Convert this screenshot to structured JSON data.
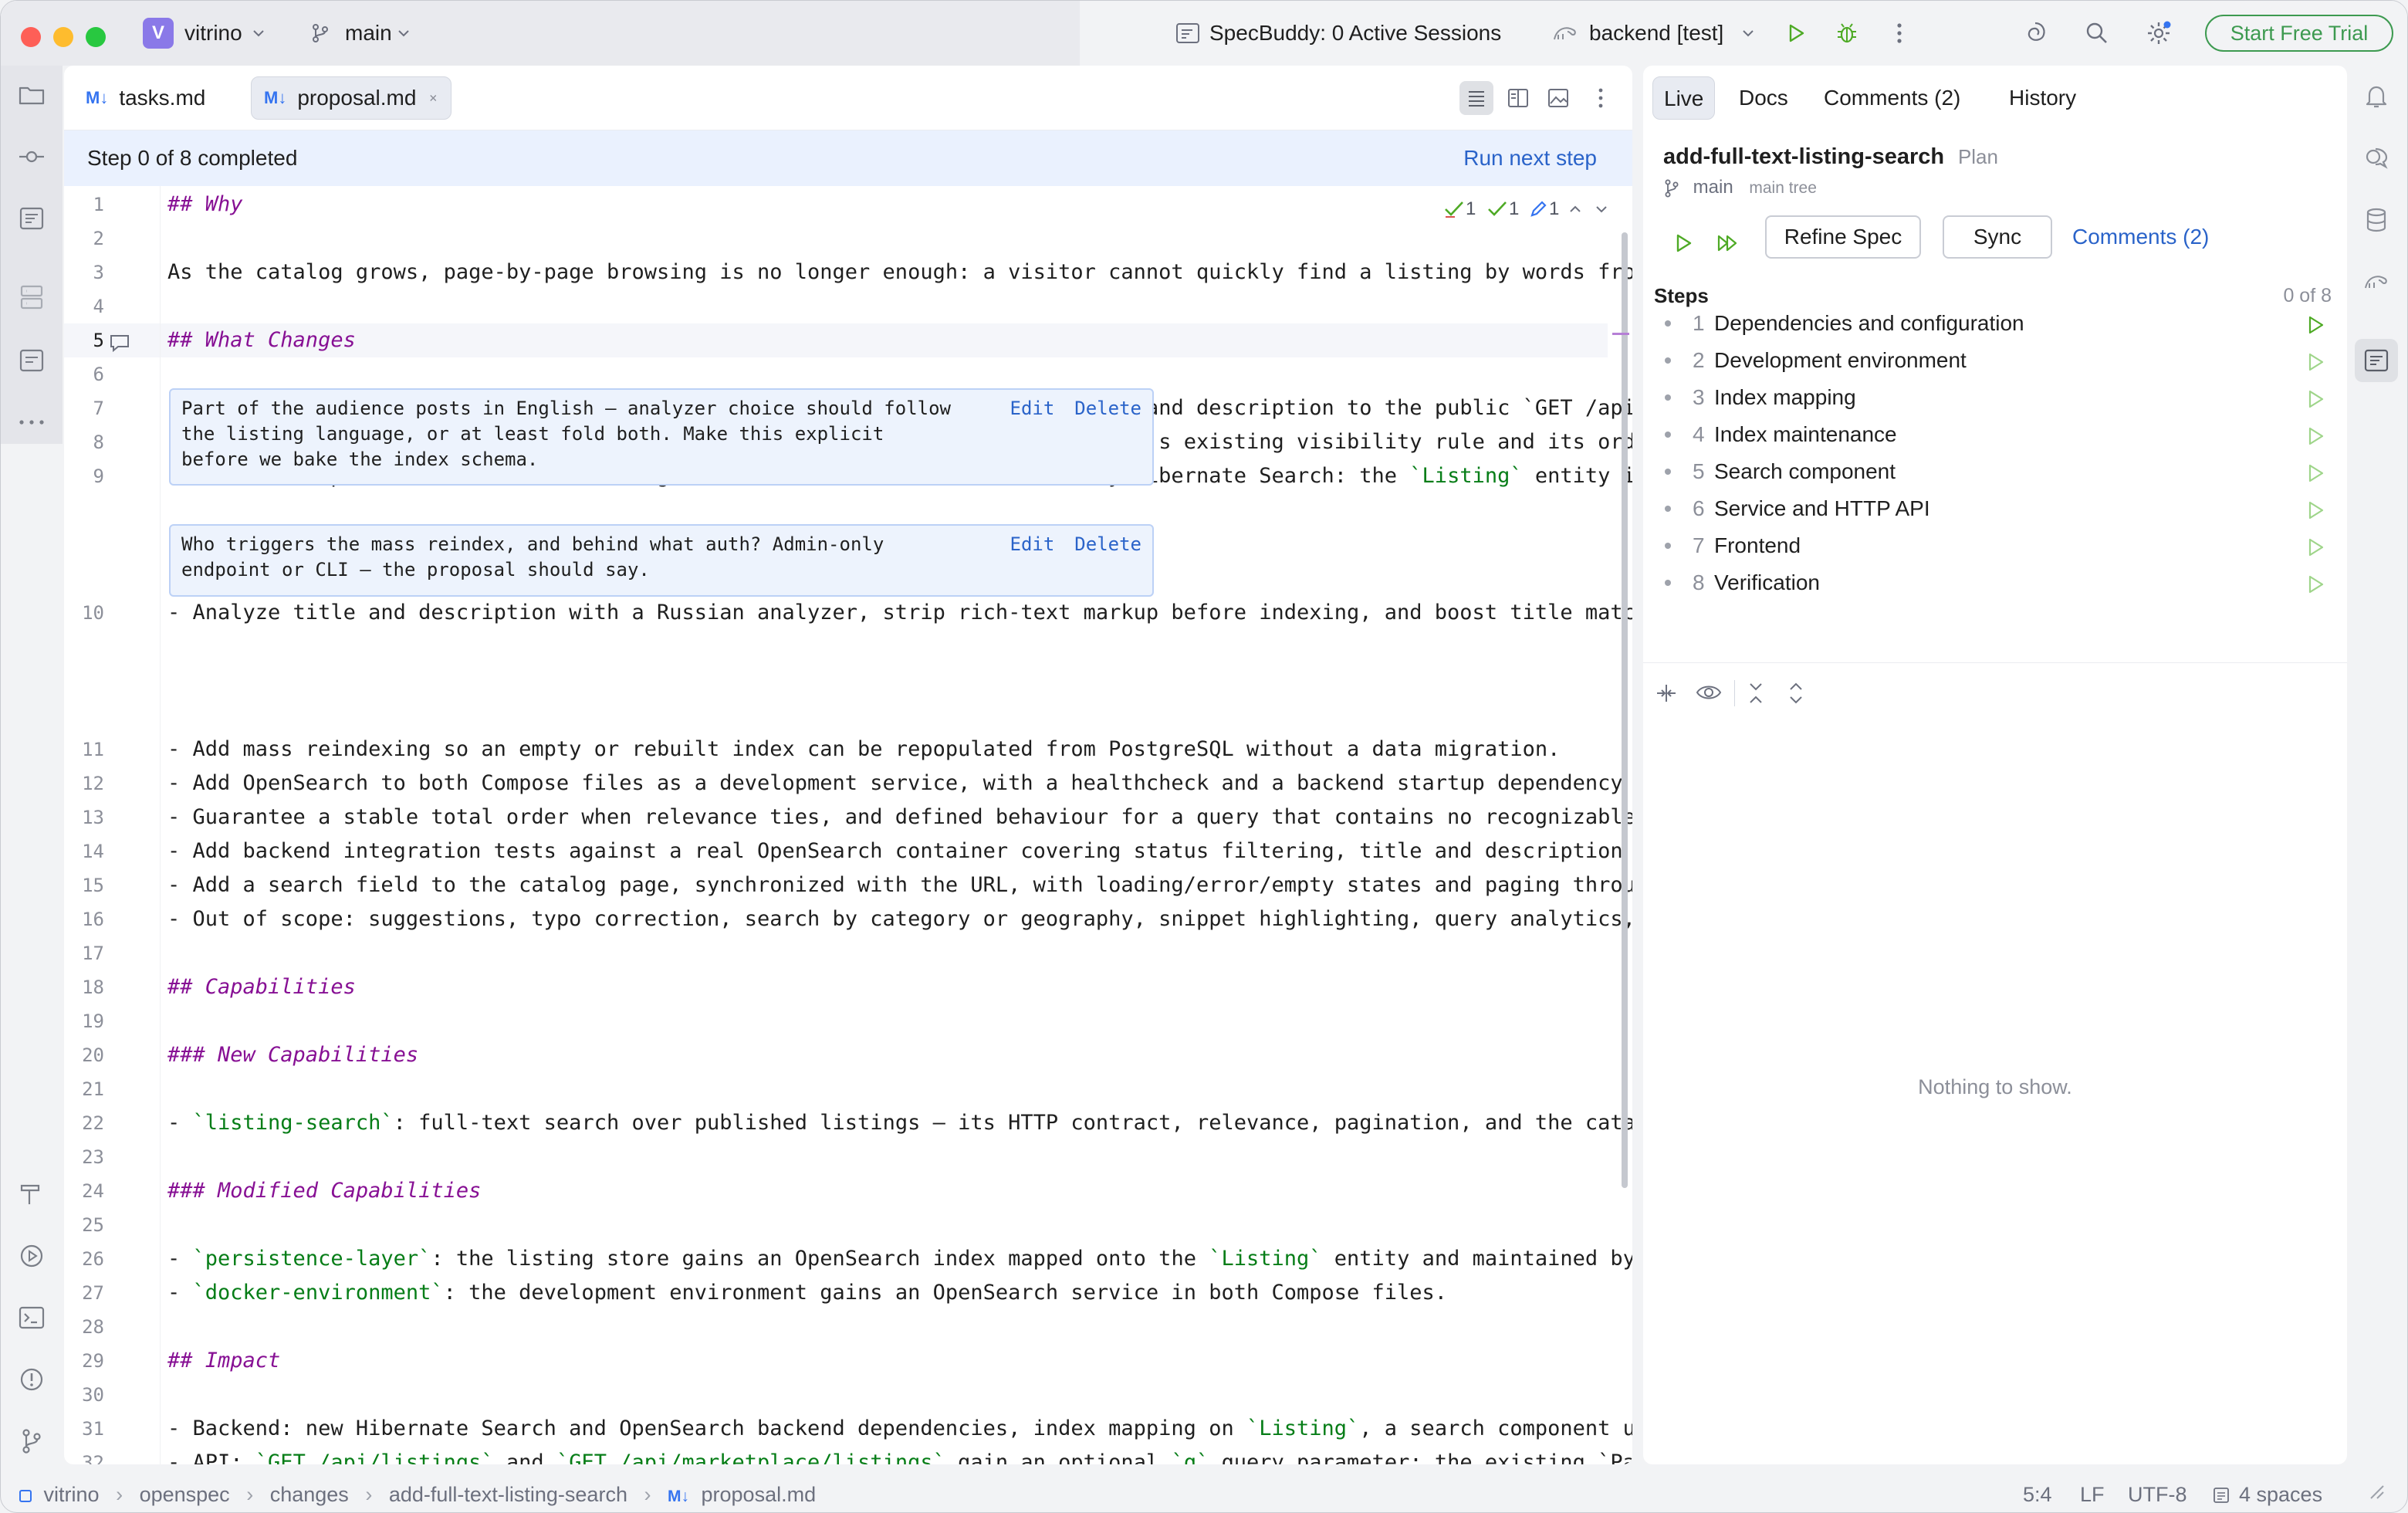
{
  "titlebar": {
    "project_initial": "V",
    "project": "vitrino",
    "branch": "main",
    "specbuddy": "SpecBuddy: 0 Active Sessions",
    "run_config": "backend [test]",
    "trial_button": "Start Free Trial"
  },
  "editor": {
    "tabs": [
      {
        "badge": "M↓",
        "label": "tasks.md"
      },
      {
        "badge": "M↓",
        "label": "proposal.md"
      }
    ],
    "step_status": "Step 0 of 8 completed",
    "run_next": "Run next step",
    "inspections": {
      "a": "1",
      "b": "1",
      "c": "1"
    },
    "lines": [
      {
        "n": "1",
        "t": "## Why",
        "k": "h"
      },
      {
        "n": "2",
        "t": ""
      },
      {
        "n": "3",
        "t": "As the catalog grows, page-by-page browsing is no longer enough: a visitor cannot quickly find a listing by words from its"
      },
      {
        "n": "4",
        "t": ""
      },
      {
        "n": "5",
        "t": "## What Changes",
        "k": "h"
      },
      {
        "n": "6",
        "t": ""
      },
      {
        "n": "7",
        "t": "- Add an optional `q` query parameter for full-text search over listing title and description to the public `GET /api/list"
      },
      {
        "n": "8",
        "t": "- Search only among listings with status `PUBLISHED`, preserving each endpoint's existing visibility rule and its ordinary"
      },
      {
        "n": "9",
        "t": "- Introduce OpenSearch as the search engine, driven from the domain model by Hibernate Search: the `Listing` entity is map"
      },
      {
        "n": "10",
        "t": "- Analyze title and description with a Russian analyzer, strip rich-text markup before indexing, and boost title matches a"
      },
      {
        "n": "11",
        "t": "- Add mass reindexing so an empty or rebuilt index can be repopulated from PostgreSQL without a data migration."
      },
      {
        "n": "12",
        "t": "- Add OpenSearch to both Compose files as a development service, with a healthcheck and a backend startup dependency on it"
      },
      {
        "n": "13",
        "t": "- Guarantee a stable total order when relevance ties, and defined behaviour for a query that contains no recognizable toke"
      },
      {
        "n": "14",
        "t": "- Add backend integration tests against a real OpenSearch container covering status filtering, title and description match"
      },
      {
        "n": "15",
        "t": "- Add a search field to the catalog page, synchronized with the URL, with loading/error/empty states and paging through re"
      },
      {
        "n": "16",
        "t": "- Out of scope: suggestions, typo correction, search by category or geography, snippet highlighting, query analytics, and"
      },
      {
        "n": "17",
        "t": ""
      },
      {
        "n": "18",
        "t": "## Capabilities",
        "k": "h"
      },
      {
        "n": "19",
        "t": ""
      },
      {
        "n": "20",
        "t": "### New Capabilities",
        "k": "h"
      },
      {
        "n": "21",
        "t": ""
      },
      {
        "n": "22",
        "t": "- `listing-search`: full-text search over published listings — its HTTP contract, relevance, pagination, and the catalog p"
      },
      {
        "n": "23",
        "t": ""
      },
      {
        "n": "24",
        "t": "### Modified Capabilities",
        "k": "h"
      },
      {
        "n": "25",
        "t": ""
      },
      {
        "n": "26",
        "t": "- `persistence-layer`: the listing store gains an OpenSearch index mapped onto the `Listing` entity and maintained by Hibe"
      },
      {
        "n": "27",
        "t": "- `docker-environment`: the development environment gains an OpenSearch service in both Compose files."
      },
      {
        "n": "28",
        "t": ""
      },
      {
        "n": "29",
        "t": "## Impact",
        "k": "h"
      },
      {
        "n": "30",
        "t": ""
      },
      {
        "n": "31",
        "t": "- Backend: new Hibernate Search and OpenSearch backend dependencies, index mapping on `Listing`, a search component using"
      },
      {
        "n": "32",
        "t": "- API: `GET /api/listings` and `GET /api/marketplace/listings` gain an optional `q` query parameter; the existing `Page<…L"
      }
    ],
    "comments": [
      {
        "text": "Part of the audience posts in English — analyzer choice should follow\nthe listing language, or at least fold both. Make this explicit\nbefore we bake the index schema.",
        "edit": "Edit",
        "delete": "Delete"
      },
      {
        "text": "Who triggers the mass reindex, and behind what auth? Admin-only\nendpoint or CLI — the proposal should say.",
        "edit": "Edit",
        "delete": "Delete"
      }
    ]
  },
  "panel": {
    "tabs": [
      "Live",
      "Docs",
      "Comments (2)",
      "History"
    ],
    "spec_name": "add-full-text-listing-search",
    "spec_type": "Plan",
    "branch": "main",
    "tree": "main tree",
    "refine_button": "Refine Spec",
    "sync_button": "Sync",
    "comments_link": "Comments (2)",
    "steps_title": "Steps",
    "steps_count": "0 of 8",
    "steps": [
      {
        "n": "1",
        "label": "Dependencies and configuration"
      },
      {
        "n": "2",
        "label": "Development environment"
      },
      {
        "n": "3",
        "label": "Index mapping"
      },
      {
        "n": "4",
        "label": "Index maintenance"
      },
      {
        "n": "5",
        "label": "Search component"
      },
      {
        "n": "6",
        "label": "Service and HTTP API"
      },
      {
        "n": "7",
        "label": "Frontend"
      },
      {
        "n": "8",
        "label": "Verification"
      }
    ],
    "empty_text": "Nothing to show."
  },
  "statusbar": {
    "breadcrumb": [
      "vitrino",
      "openspec",
      "changes",
      "add-full-text-listing-search",
      "proposal.md"
    ],
    "md_badge": "M↓",
    "position": "5:4",
    "line_sep": "LF",
    "encoding": "UTF-8",
    "indent": "4 spaces"
  },
  "colors": {
    "accent": "#3574f0",
    "heading": "#871094",
    "code": "#067d17",
    "run_green": "#4eaa25",
    "trial_green": "#3d9a50"
  }
}
